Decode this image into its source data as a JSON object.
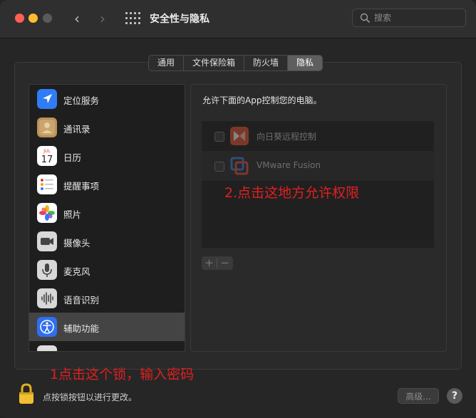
{
  "window": {
    "title": "安全性与隐私"
  },
  "search": {
    "placeholder": "搜索"
  },
  "tabs": [
    {
      "label": "通用",
      "active": false
    },
    {
      "label": "文件保险箱",
      "active": false
    },
    {
      "label": "防火墙",
      "active": false
    },
    {
      "label": "隐私",
      "active": true
    }
  ],
  "sidebar": {
    "items": [
      {
        "label": "定位服务",
        "icon": "location-arrow-icon"
      },
      {
        "label": "通讯录",
        "icon": "contacts-icon"
      },
      {
        "label": "日历",
        "icon": "calendar-icon",
        "month": "JUL",
        "day": "17"
      },
      {
        "label": "提醒事项",
        "icon": "reminders-icon"
      },
      {
        "label": "照片",
        "icon": "photos-icon"
      },
      {
        "label": "摄像头",
        "icon": "camera-icon"
      },
      {
        "label": "麦克风",
        "icon": "microphone-icon"
      },
      {
        "label": "语音识别",
        "icon": "speech-waveform-icon"
      },
      {
        "label": "辅助功能",
        "icon": "accessibility-icon",
        "selected": true
      }
    ]
  },
  "content": {
    "caption": "允许下面的App控制您的电脑。",
    "apps": [
      {
        "name": "向日葵远程控制",
        "checked": false,
        "icon": "sunlogin-icon"
      },
      {
        "name": "VMware Fusion",
        "checked": false,
        "icon": "vmware-icon"
      }
    ],
    "add_label": "+",
    "remove_label": "−"
  },
  "annotations": {
    "step1": "1点击这个锁，输入密码",
    "step2": "2.点击这地方允许权限",
    "color": "#e02020"
  },
  "footer": {
    "lock_message": "点按锁按钮以进行更改。",
    "advanced_label": "高级...",
    "help_label": "?"
  },
  "colors": {
    "accent_red": "#ff5f57",
    "accent_yellow": "#febc2e",
    "selection": "#444444"
  }
}
